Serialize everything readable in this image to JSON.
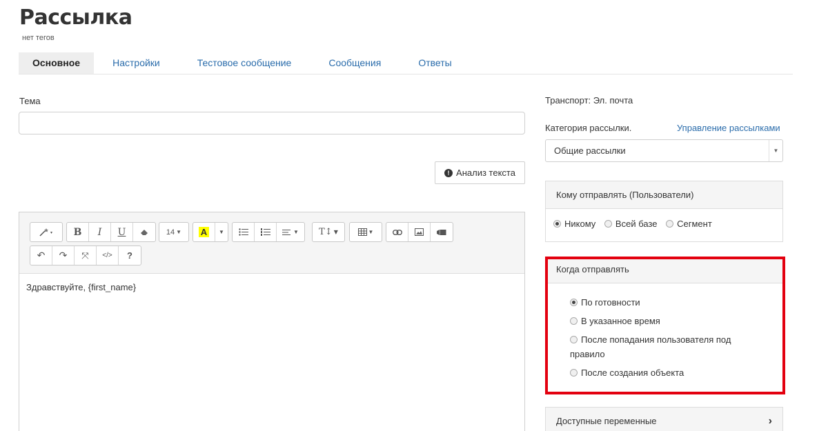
{
  "page": {
    "title": "Рассылка",
    "tags": "нет тегов"
  },
  "tabs": [
    {
      "label": "Основное",
      "active": true
    },
    {
      "label": "Настройки"
    },
    {
      "label": "Тестовое сообщение"
    },
    {
      "label": "Сообщения"
    },
    {
      "label": "Ответы"
    }
  ],
  "form": {
    "subject_label": "Тема",
    "subject_value": "",
    "analyze_button": "Анализ текста"
  },
  "editor": {
    "toolbar": {
      "font_size": "14",
      "magic_icon": "magic-wand-icon",
      "bold": "B",
      "italic": "I",
      "underline": "U",
      "table_icon": "table-icon",
      "help": "?",
      "code": "</>",
      "highlight_color": "#ffff00"
    },
    "content": "Здравствуйте, {first_name}"
  },
  "sidebar": {
    "transport": "Транспорт: Эл. почта",
    "category_label": "Категория рассылки.",
    "manage_link": "Управление рассылками",
    "category_value": "Общие рассылки",
    "recipients": {
      "title": "Кому отправлять (Пользователи)",
      "options": [
        {
          "label": "Никому",
          "checked": true
        },
        {
          "label": "Всей базе"
        },
        {
          "label": "Сегмент"
        }
      ]
    },
    "when": {
      "title": "Когда отправлять",
      "options": [
        {
          "label": "По готовности",
          "checked": true
        },
        {
          "label": "В указанное время"
        },
        {
          "label": "После попадания пользователя под"
        },
        {
          "label": "правило"
        },
        {
          "label": "После создания объекта"
        }
      ]
    },
    "variables": "Доступные переменные"
  },
  "colors": {
    "link": "#2a6cab",
    "highlight_frame": "#e3000f"
  }
}
